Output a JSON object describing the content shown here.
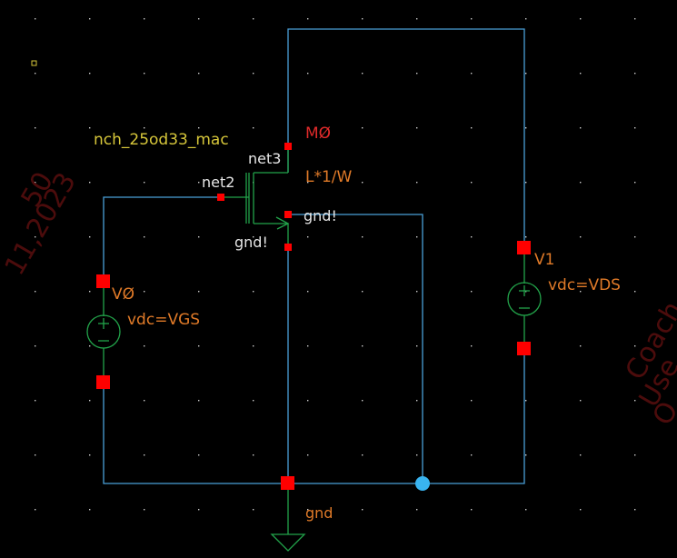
{
  "colors": {
    "background": "#000000",
    "wire": "#4a9fd8",
    "device": "#22a34a",
    "pin": "#ff0000",
    "label_orange": "#e07a28",
    "label_white": "#e6e6e6",
    "label_yellow": "#d6c63a",
    "instance_red": "#e02a2a",
    "junction": "#39b4f0",
    "grid_dot": "#cfcfcf",
    "watermark": "#5a0f0f"
  },
  "transistor": {
    "model": "nch_25od33_mac",
    "instance": "MØ",
    "size": "L*1/W",
    "drain_net": "net3",
    "gate_net": "net2",
    "source_net": "gnd!",
    "bulk_net": "gnd!"
  },
  "sources": {
    "v0": {
      "instance": "VØ",
      "param": "vdc=VGS"
    },
    "v1": {
      "instance": "V1",
      "param": "vdc=VDS"
    }
  },
  "ground": {
    "label": "gnd"
  },
  "watermark": {
    "left": [
      "50",
      "11,2023"
    ],
    "right": [
      "Coach",
      "Use",
      "O"
    ]
  },
  "icons": {
    "mosfet": "nmos-symbol-icon",
    "source": "dc-voltage-source-icon",
    "ground": "ground-symbol-icon"
  }
}
